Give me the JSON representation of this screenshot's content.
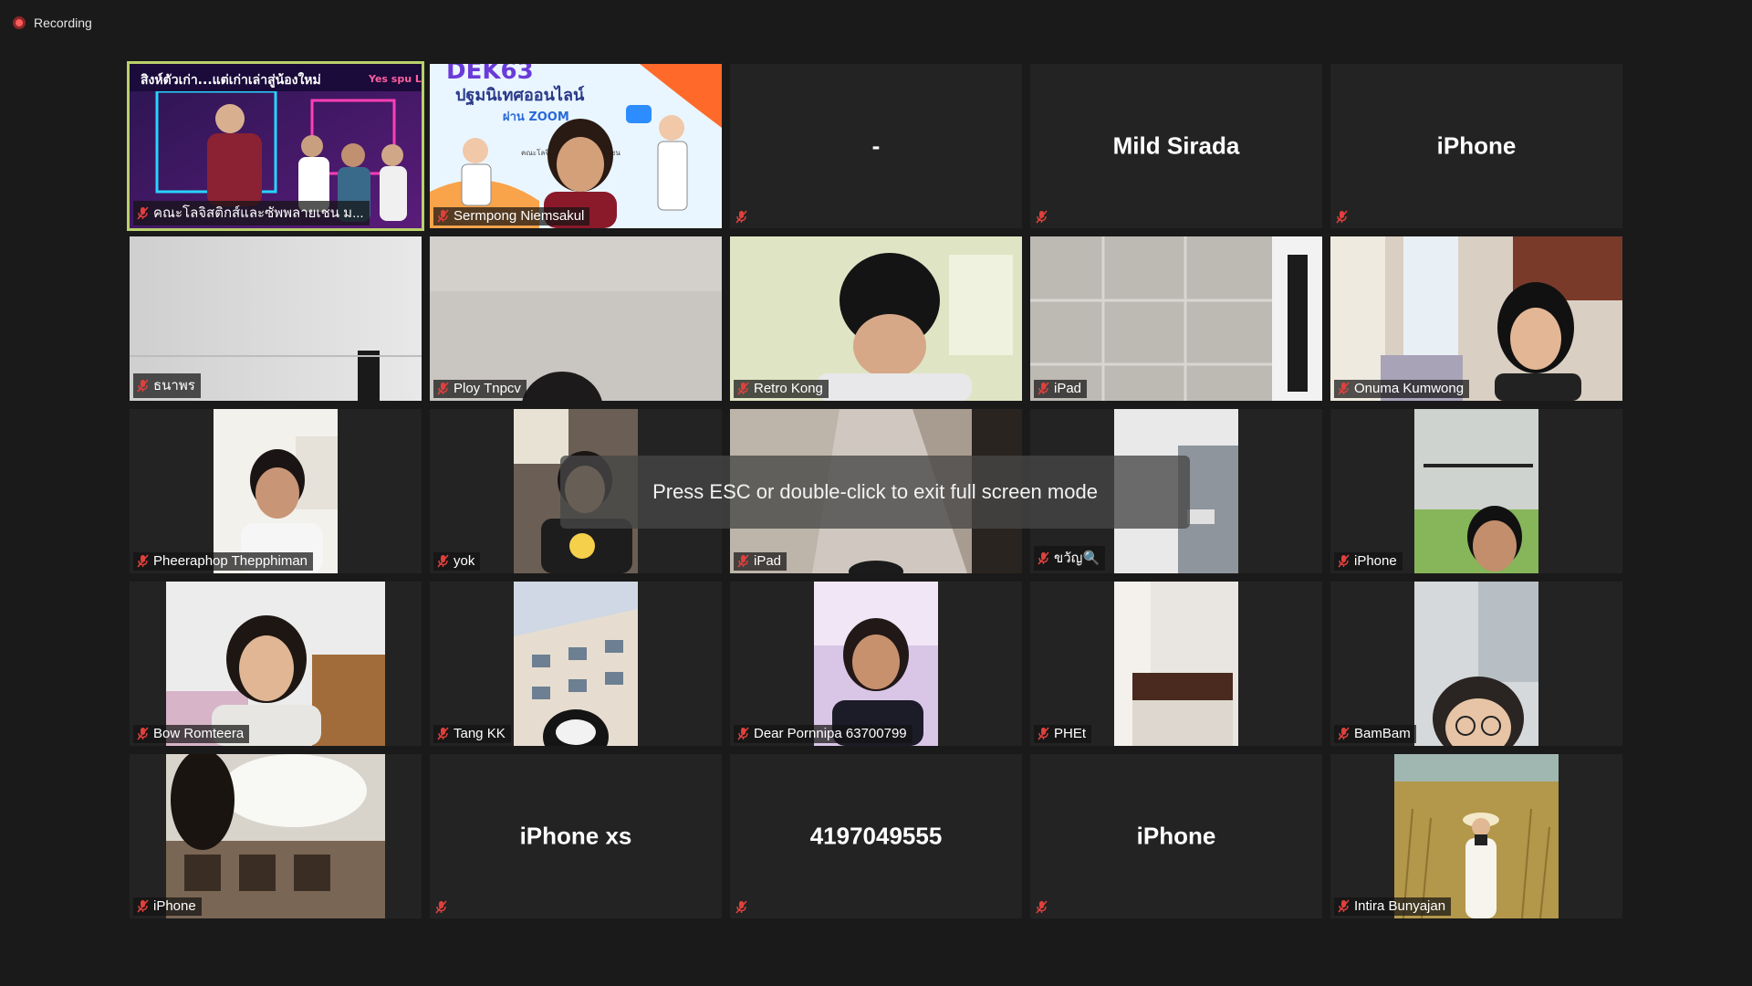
{
  "recording": {
    "label": "Recording"
  },
  "overlay": {
    "message": "Press ESC or double-click to exit full screen mode"
  },
  "tiles": [
    {
      "name": "คณะโลจิสติกส์และซัพพลายเชน ม...",
      "type": "video",
      "muted": true,
      "active": true,
      "scene": "stage",
      "banner_text": "สิงห์ตัวเก่า...แต่เก่าเล่าสู่น้องใหม่",
      "logo_text": "Yes spu LOGISTICS"
    },
    {
      "name": "Sermpong Niemsakul",
      "type": "video",
      "muted": true,
      "scene": "poster",
      "poster_title": "DEK63",
      "poster_line": "ปฐมนิเทศออนไลน์",
      "poster_sub": "ผ่าน ZOOM",
      "poster_org": "คณะโลจิสติกส์และซัพพลายเชน"
    },
    {
      "name": "",
      "type": "name",
      "muted": true,
      "display": "-"
    },
    {
      "name": "",
      "type": "name",
      "muted": true,
      "display": "Mild Sirada"
    },
    {
      "name": "",
      "type": "name",
      "muted": true,
      "display": "iPhone"
    },
    {
      "name": "ธนาพร",
      "type": "video",
      "muted": true,
      "scene": "wall"
    },
    {
      "name": "Ploy Tnpcv",
      "type": "video",
      "muted": true,
      "scene": "wall-head"
    },
    {
      "name": "Retro Kong",
      "type": "video",
      "muted": true,
      "scene": "boy"
    },
    {
      "name": "iPad",
      "type": "video",
      "muted": true,
      "scene": "tiles"
    },
    {
      "name": "Onuma Kumwong",
      "type": "video",
      "muted": true,
      "scene": "girl-room"
    },
    {
      "name": "Pheeraphop Thepphiman",
      "type": "video",
      "muted": true,
      "scene": "portrait-man"
    },
    {
      "name": "yok",
      "type": "video",
      "muted": true,
      "scene": "portrait-girl"
    },
    {
      "name": "iPad",
      "type": "video",
      "muted": true,
      "scene": "ceiling"
    },
    {
      "name": "ขวัญ🔍",
      "type": "video",
      "muted": true,
      "scene": "portrait-car"
    },
    {
      "name": "iPhone",
      "type": "video",
      "muted": true,
      "scene": "portrait-ceiling-man"
    },
    {
      "name": "Bow Romteera",
      "type": "video",
      "muted": true,
      "scene": "portrait-woman-room"
    },
    {
      "name": "Tang KK",
      "type": "video",
      "muted": true,
      "scene": "portrait-building"
    },
    {
      "name": "Dear Pornnipa 63700799",
      "type": "video",
      "muted": true,
      "scene": "portrait-purple"
    },
    {
      "name": "PHEt",
      "type": "video",
      "muted": true,
      "scene": "portrait-wall"
    },
    {
      "name": "BamBam",
      "type": "video",
      "muted": true,
      "scene": "portrait-glasses"
    },
    {
      "name": "iPhone",
      "type": "video",
      "muted": true,
      "scene": "portrait-room-blur"
    },
    {
      "name": "",
      "type": "name",
      "muted": true,
      "display": "iPhone xs"
    },
    {
      "name": "",
      "type": "name",
      "muted": true,
      "display": "4197049555"
    },
    {
      "name": "",
      "type": "name",
      "muted": true,
      "display": "iPhone"
    },
    {
      "name": "Intira Bunyajan",
      "type": "video",
      "muted": true,
      "scene": "portrait-field"
    }
  ],
  "colors": {
    "active_border": "#b9d16a",
    "background": "#1a1a1a",
    "tile": "#232323",
    "mic_muted": "#e0403c"
  }
}
